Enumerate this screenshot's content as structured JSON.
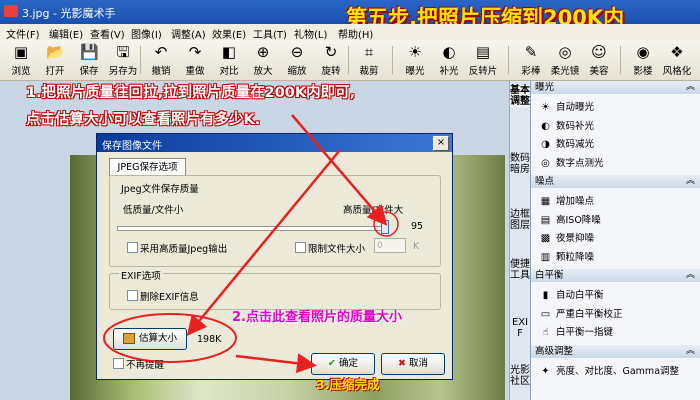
{
  "window": {
    "title": "3.jpg - 光影魔术手"
  },
  "overlay": {
    "step_title": "第五步,把照片压缩到200K内",
    "step1_line1": "1.把照片质量往回拉,拉到照片质量在200K内即可,",
    "step1_line2": "点击估算大小可以查看照片有多少K.",
    "step2": "2.点击此查看照片的质量大小",
    "step3": "3.压缩完成"
  },
  "menu": [
    "文件(F)",
    "编辑(E)",
    "查看(V)",
    "图像(I)",
    "调整(A)",
    "效果(E)",
    "工具(T)",
    "礼物(L)",
    "帮助(H)"
  ],
  "toolbar": [
    {
      "label": "浏览",
      "icon": "browse-icon",
      "glyph": "▣"
    },
    {
      "label": "打开",
      "icon": "open-icon",
      "glyph": "📂"
    },
    {
      "label": "保存",
      "icon": "save-icon",
      "glyph": "💾"
    },
    {
      "label": "另存为",
      "icon": "save-as-icon",
      "glyph": "🖫"
    },
    {
      "label": "撤销",
      "icon": "undo-icon",
      "glyph": "↶"
    },
    {
      "label": "重做",
      "icon": "redo-icon",
      "glyph": "↷"
    },
    {
      "label": "对比",
      "icon": "compare-icon",
      "glyph": "◧"
    },
    {
      "label": "放大",
      "icon": "zoom-in-icon",
      "glyph": "⊕"
    },
    {
      "label": "缩放",
      "icon": "resize-icon",
      "glyph": "⊖"
    },
    {
      "label": "旋转",
      "icon": "rotate-icon",
      "glyph": "↻"
    },
    {
      "label": "裁剪",
      "icon": "crop-icon",
      "glyph": "⌗"
    },
    {
      "label": "曝光",
      "icon": "exposure-icon",
      "glyph": "☀"
    },
    {
      "label": "补光",
      "icon": "fill-light-icon",
      "glyph": "◐"
    },
    {
      "label": "反转片",
      "icon": "reversal-film-icon",
      "glyph": "▤"
    },
    {
      "label": "彩棒",
      "icon": "color-stick-icon",
      "glyph": "✎"
    },
    {
      "label": "柔光镜",
      "icon": "soft-light-icon",
      "glyph": "◎"
    },
    {
      "label": "美容",
      "icon": "beauty-icon",
      "glyph": "☺"
    },
    {
      "label": "影楼",
      "icon": "studio-icon",
      "glyph": "◉"
    },
    {
      "label": "风格化",
      "icon": "stylize-icon",
      "glyph": "❖"
    }
  ],
  "dialog": {
    "title": "保存图像文件",
    "close": "×",
    "tab": "JPEG保存选项",
    "quality_group": "Jpeg文件保存质量",
    "low_label": "低质量/文件小",
    "high_label": "高质量/文件大",
    "quality_value": "95",
    "high_quality_checkbox": "采用高质量Jpeg输出",
    "limit_size_checkbox": "限制文件大小",
    "limit_size_value": "0",
    "limit_size_unit": "K",
    "exif_group": "EXIF选项",
    "remove_exif_checkbox": "删除EXIF信息",
    "estimate_button": "估算大小",
    "estimate_result": "198K",
    "no_remind_checkbox": "不再提醒",
    "ok_button": "确定",
    "cancel_button": "取消"
  },
  "side_tabs": [
    "基本调整",
    "数码暗房",
    "边框图层",
    "便捷工具",
    "EXIF",
    "光影社区"
  ],
  "panel": {
    "sections": [
      {
        "title": "曝光",
        "items": [
          "自动曝光",
          "数码补光",
          "数码减光",
          "数字点测光"
        ]
      },
      {
        "title": "噪点",
        "items": [
          "增加噪点",
          "高ISO降噪",
          "夜景抑噪",
          "颗粒降噪"
        ]
      },
      {
        "title": "白平衡",
        "items": [
          "自动白平衡",
          "严重白平衡校正",
          "白平衡一指键"
        ]
      },
      {
        "title": "高级调整",
        "items": [
          "亮度、对比度、Gamma调整"
        ]
      }
    ]
  },
  "colors": {
    "annotation_red": "#e82020",
    "annotation_magenta": "#e600cc",
    "annotation_yellow": "#ffe600"
  }
}
